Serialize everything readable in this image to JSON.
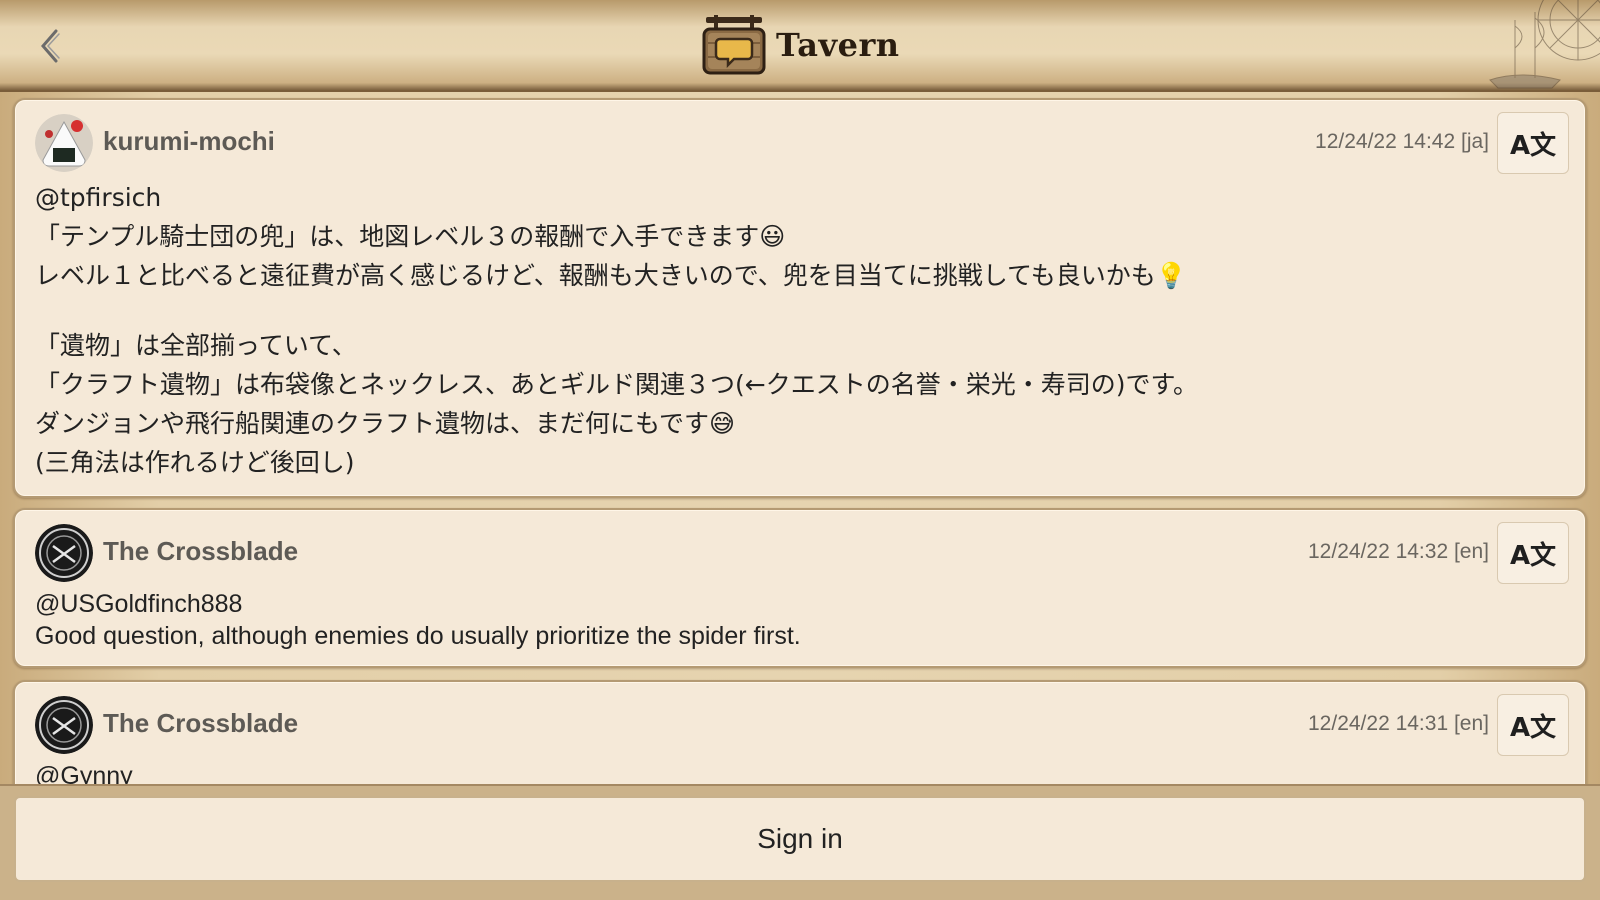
{
  "header": {
    "title": "Tavern",
    "back_icon": "chevron-left-icon",
    "tavern_icon": "tavern-sign-icon"
  },
  "posts": [
    {
      "username": "kurumi-mochi",
      "timestamp": "12/24/22 14:42 [ja]",
      "translate_label": "A文",
      "lines": [
        "@tpfirsich",
        "「テンプル騎士団の兜」は、地図レベル３の報酬で入手できます😃",
        "レベル１と比べると遠征費が高く感じるけど、報酬も大きいので、兜を目当てに挑戦しても良いかも💡",
        "",
        "「遺物」は全部揃っていて、",
        "「クラフト遺物」は布袋像とネックレス、あとギルド関連３つ(←クエストの名誉・栄光・寿司の)です。",
        "ダンジョンや飛行船関連のクラフト遺物は、まだ何にもです😅",
        "(三角法は作れるけど後回し)"
      ]
    },
    {
      "username": "The Crossblade",
      "timestamp": "12/24/22 14:32 [en]",
      "translate_label": "A文",
      "lines": [
        "@USGoldfinch888",
        "Good question, although enemies do usually prioritize the spider first."
      ]
    },
    {
      "username": "The Crossblade",
      "timestamp": "12/24/22 14:31 [en]",
      "translate_label": "A文",
      "lines": [
        "@Gynny"
      ]
    }
  ],
  "footer": {
    "signin_label": "Sign in"
  }
}
